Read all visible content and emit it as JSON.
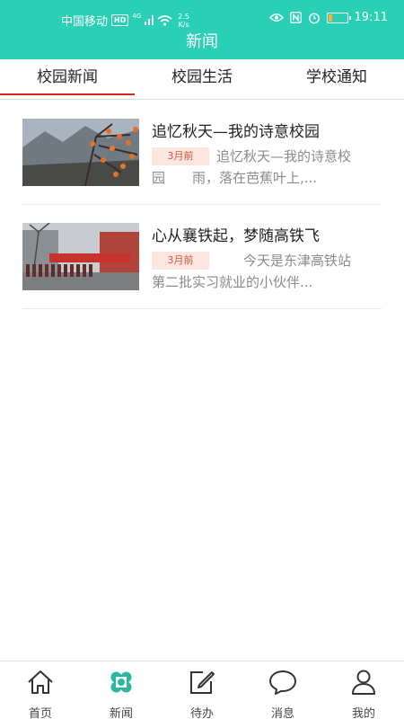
{
  "status_bar": {
    "carrier": "中国移动",
    "hd": "HD",
    "network": "4G",
    "speed_value": "2.5",
    "speed_unit": "K/s",
    "time": "19:11",
    "battery_level": 0.2
  },
  "header": {
    "title": "新闻"
  },
  "tabs": [
    {
      "label": "校园新闻",
      "active": true
    },
    {
      "label": "校园生活",
      "active": false
    },
    {
      "label": "学校通知",
      "active": false
    }
  ],
  "news": [
    {
      "title": "追忆秋天—我的诗意校园",
      "time": "3月前",
      "summary": "追忆秋天—我的诗意校园　　雨，落在芭蕉叶上,..."
    },
    {
      "title": "心从襄铁起，梦随高铁飞",
      "time": "3月前",
      "summary": "　　今天是东津高铁站第二批实习就业的小伙伴..."
    }
  ],
  "bottom_nav": [
    {
      "label": "首页",
      "icon": "home-icon"
    },
    {
      "label": "新闻",
      "icon": "news-clover-icon",
      "active": true
    },
    {
      "label": "待办",
      "icon": "edit-icon"
    },
    {
      "label": "消息",
      "icon": "message-bubble-icon"
    },
    {
      "label": "我的",
      "icon": "user-icon"
    }
  ],
  "colors": {
    "header_bg": "#2ad0b6",
    "tab_indicator": "#d6261c",
    "badge_bg": "#fde6dd",
    "badge_text": "#d9533c",
    "active_nav_icon": "#2ab9a0"
  }
}
